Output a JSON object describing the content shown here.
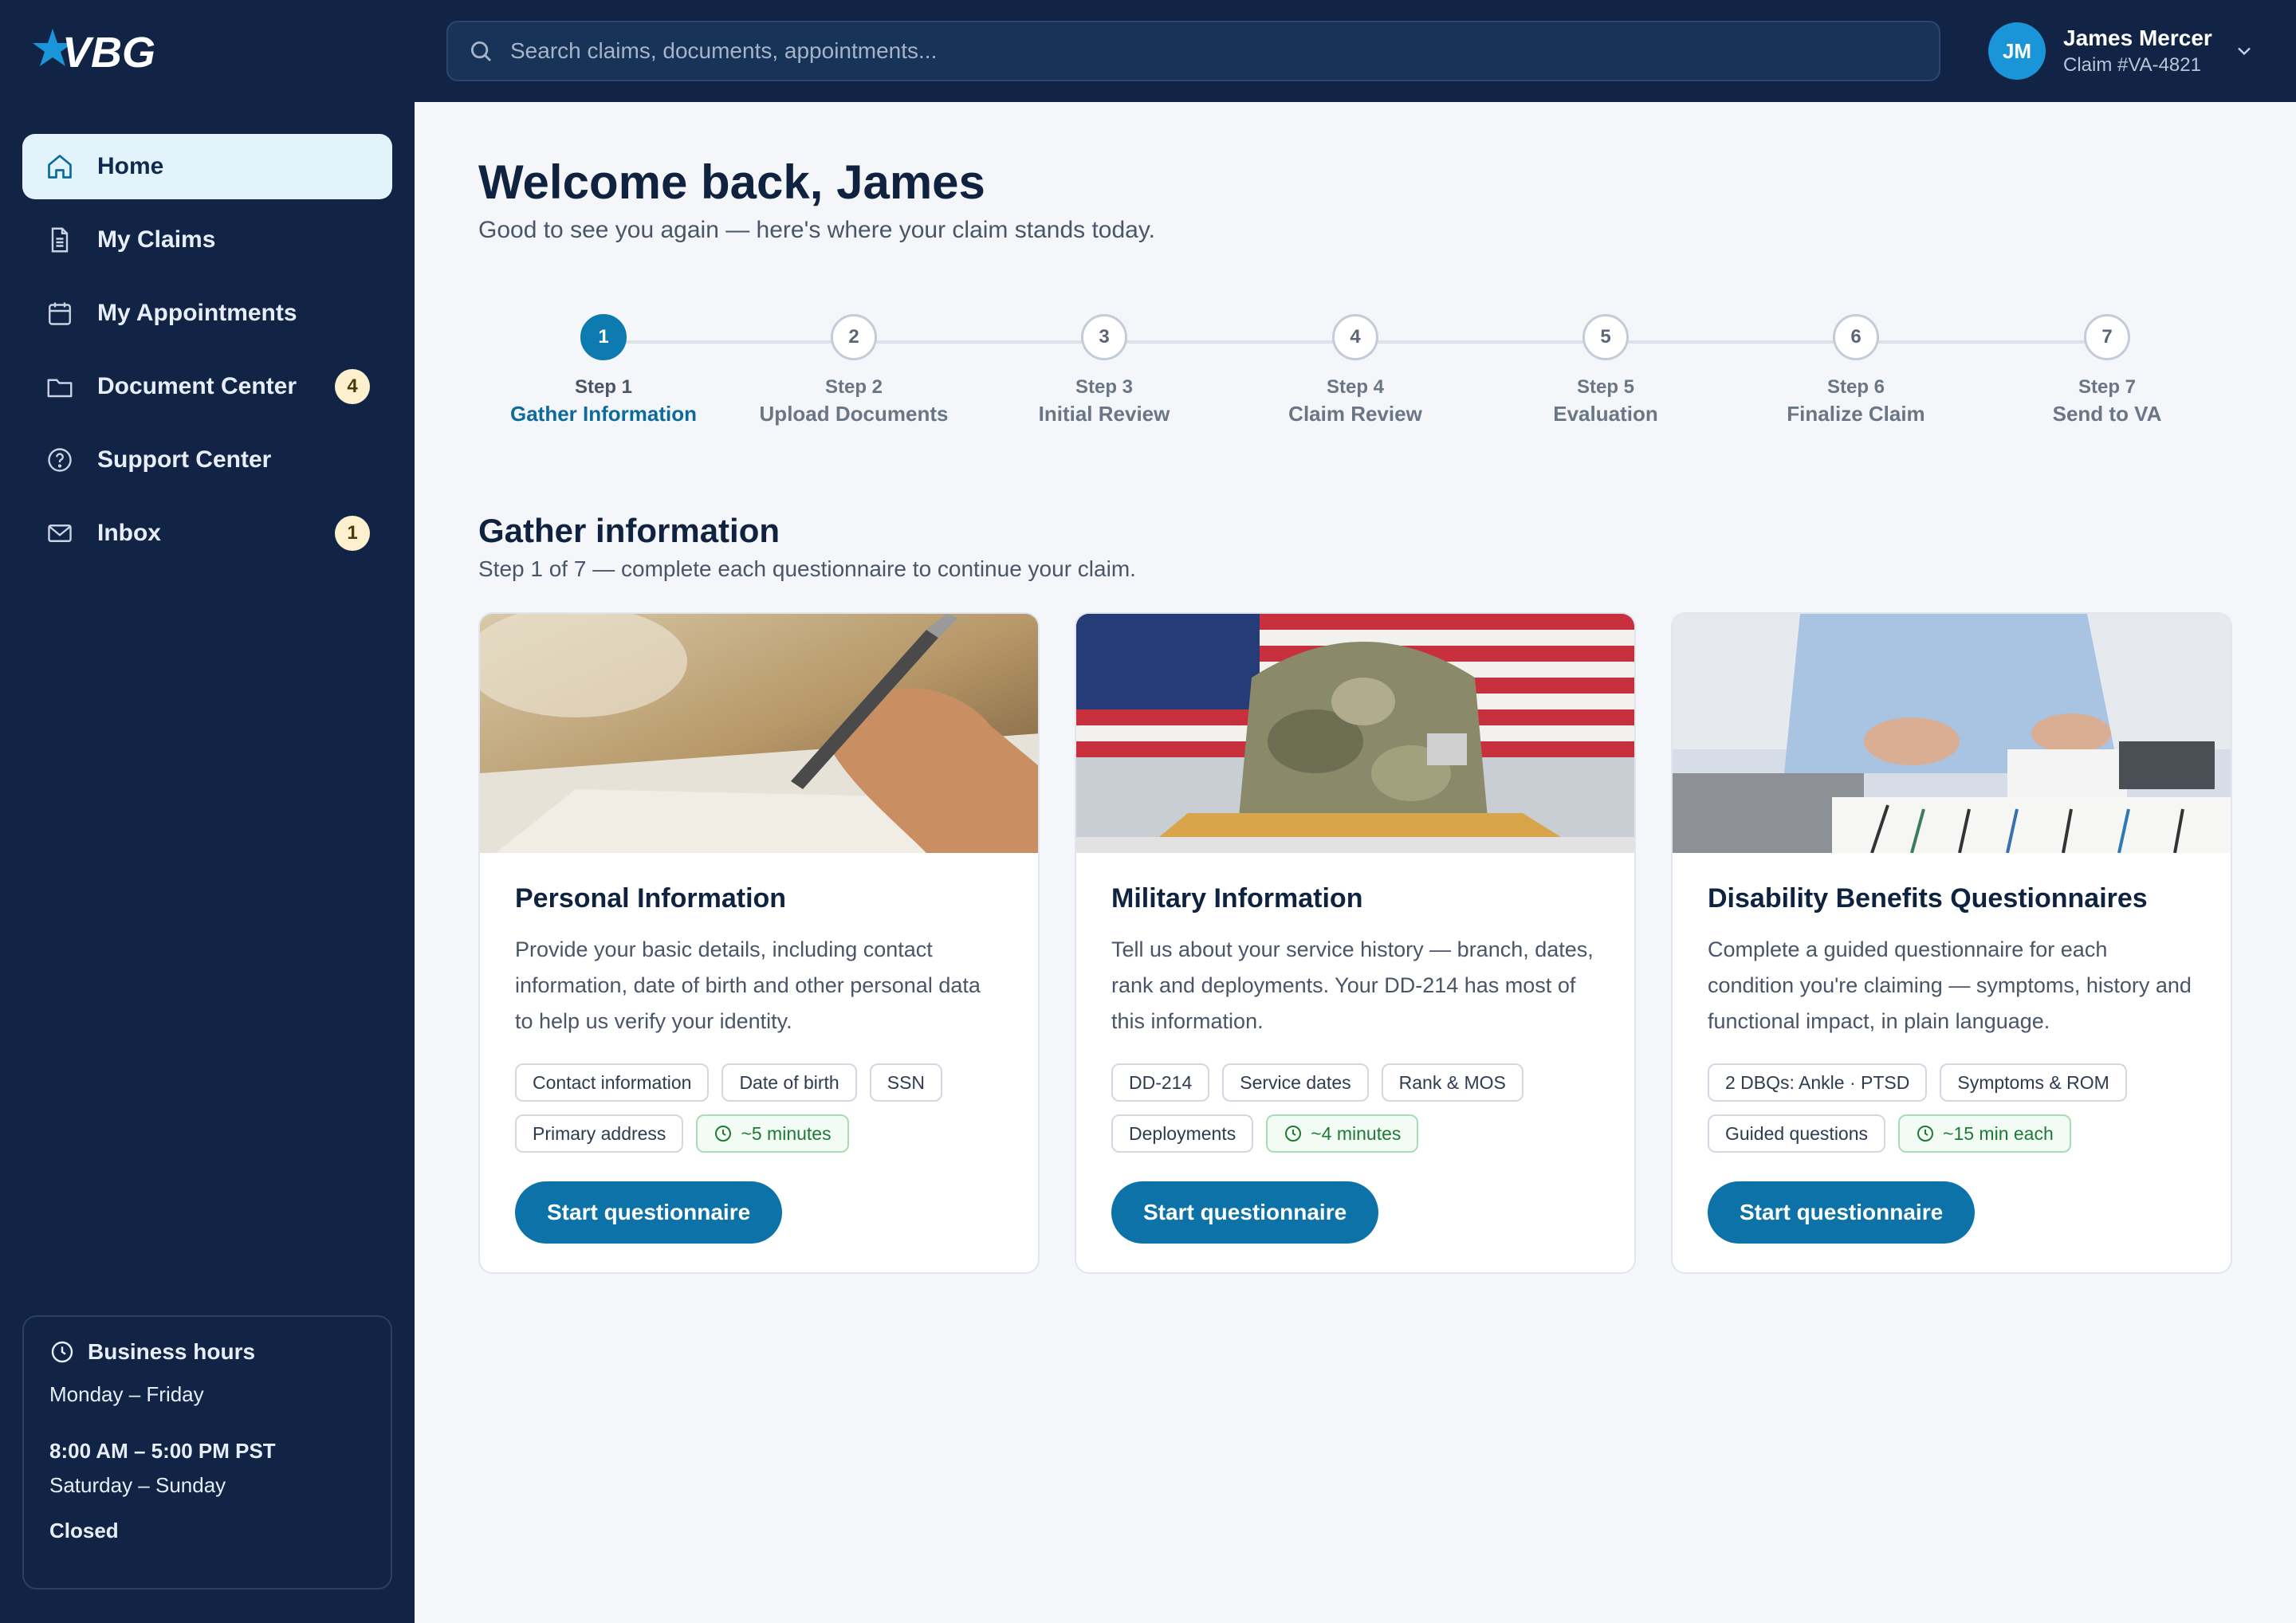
{
  "brand": {
    "logo_text": "VBG"
  },
  "search": {
    "placeholder": "Search claims, documents, appointments..."
  },
  "user": {
    "initials": "JM",
    "name": "James Mercer",
    "claim": "Claim #VA-4821"
  },
  "sidebar": {
    "items": [
      {
        "label": "Home",
        "icon": "home-icon",
        "active": true
      },
      {
        "label": "My Claims",
        "icon": "document-icon"
      },
      {
        "label": "My Appointments",
        "icon": "calendar-icon"
      },
      {
        "label": "Document Center",
        "icon": "folder-icon",
        "badge": "4"
      },
      {
        "label": "Support Center",
        "icon": "help-icon"
      },
      {
        "label": "Inbox",
        "icon": "mail-icon",
        "badge": "1"
      }
    ]
  },
  "hours": {
    "title": "Business hours",
    "weekdays": "Monday – Friday",
    "weekday_hours": "8:00 AM – 5:00 PM PST",
    "weekend": "Saturday – Sunday",
    "weekend_status": "Closed"
  },
  "welcome": {
    "title": "Welcome back, James",
    "subtitle": "Good to see you again — here's where your claim stands today."
  },
  "steps": [
    {
      "num": "1",
      "label": "Step 1",
      "name": "Gather Information",
      "active": true
    },
    {
      "num": "2",
      "label": "Step 2",
      "name": "Upload Documents"
    },
    {
      "num": "3",
      "label": "Step 3",
      "name": "Initial Review"
    },
    {
      "num": "4",
      "label": "Step 4",
      "name": "Claim Review"
    },
    {
      "num": "5",
      "label": "Step 5",
      "name": "Evaluation"
    },
    {
      "num": "6",
      "label": "Step 6",
      "name": "Finalize Claim"
    },
    {
      "num": "7",
      "label": "Step 7",
      "name": "Send to VA"
    }
  ],
  "section": {
    "title": "Gather information",
    "subtitle": "Step 1 of 7 — complete each questionnaire to continue your claim."
  },
  "cards": [
    {
      "title": "Personal Information",
      "desc": "Provide your basic details, including contact information, date of birth and other personal data to help us verify your identity.",
      "chips": [
        "Contact information",
        "Date of birth",
        "SSN",
        "Primary address"
      ],
      "time": "~5 minutes",
      "button": "Start questionnaire"
    },
    {
      "title": "Military Information",
      "desc": "Tell us about your service history — branch, dates, rank and deployments. Your DD-214 has most of this information.",
      "chips": [
        "DD-214",
        "Service dates",
        "Rank & MOS",
        "Deployments"
      ],
      "time": "~4 minutes",
      "button": "Start questionnaire"
    },
    {
      "title": "Disability Benefits Questionnaires",
      "desc": "Complete a guided questionnaire for each condition you're claiming — symptoms, history and functional impact, in plain language.",
      "chips": [
        "2 DBQs: Ankle · PTSD",
        "Symptoms & ROM",
        "Guided questions"
      ],
      "time": "~15 min each",
      "button": "Start questionnaire"
    }
  ]
}
